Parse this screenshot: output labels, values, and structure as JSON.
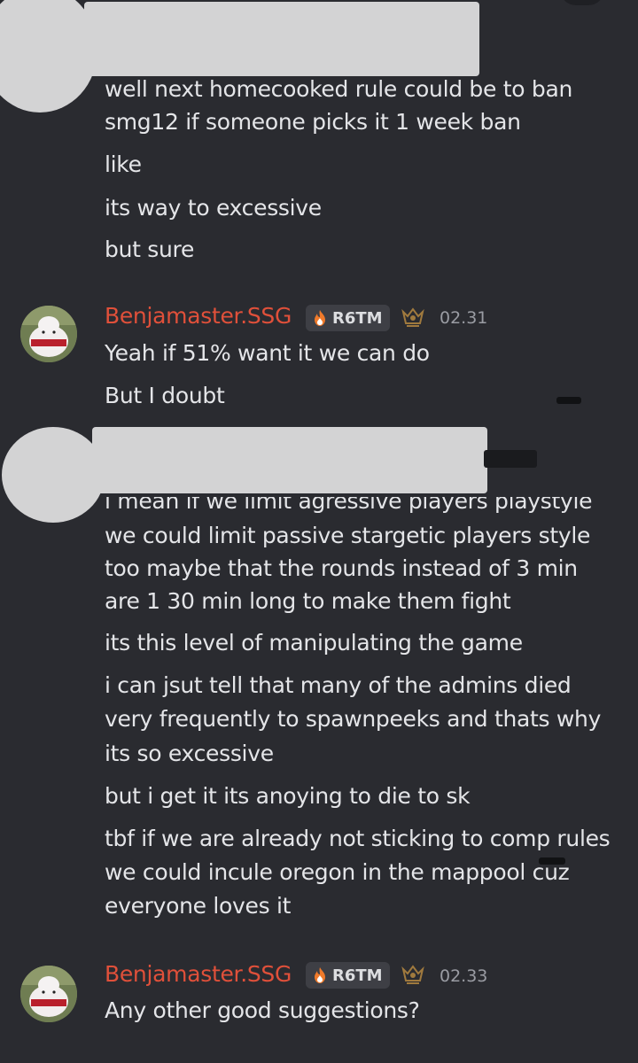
{
  "messages": [
    {
      "lines": [
        "well next homecooked rule could be to ban",
        "smg12 if someone picks it 1 week ban",
        "like",
        "its way to excessive",
        "but sure"
      ]
    },
    {
      "author": "Benjamaster.SSG",
      "tag": "R6TM",
      "time": "02.31",
      "lines": [
        "Yeah if 51% want it we can do",
        "But I doubt"
      ]
    },
    {
      "lines": [
        "i mean if we limit agressive players playstyle",
        "we could limit passive stargetic players style",
        "too maybe that the rounds instead of 3 min",
        "are 1 30 min long to make them fight",
        "its this level of manipulating the game",
        "i can jsut tell that many of the admins died",
        "very frequently to spawnpeeks and thats why",
        "its so excessive",
        "but i get it its anoying to die to sk",
        "tbf if we are already not sticking to comp rules",
        "we could incule oregon in the mappool cuz",
        "everyone loves it"
      ]
    },
    {
      "author": "Benjamaster.SSG",
      "tag": "R6TM",
      "time": "02.33",
      "lines": [
        "Any other good suggestions?"
      ]
    }
  ],
  "colors": {
    "background": "#2a2b30",
    "username": "#e0503a",
    "text": "#e4e5e8",
    "timestamp": "#9a9ca3",
    "redaction": "#d3d3d4"
  },
  "icons": [
    "flame-icon",
    "crown-badge-icon",
    "avatar-image"
  ]
}
